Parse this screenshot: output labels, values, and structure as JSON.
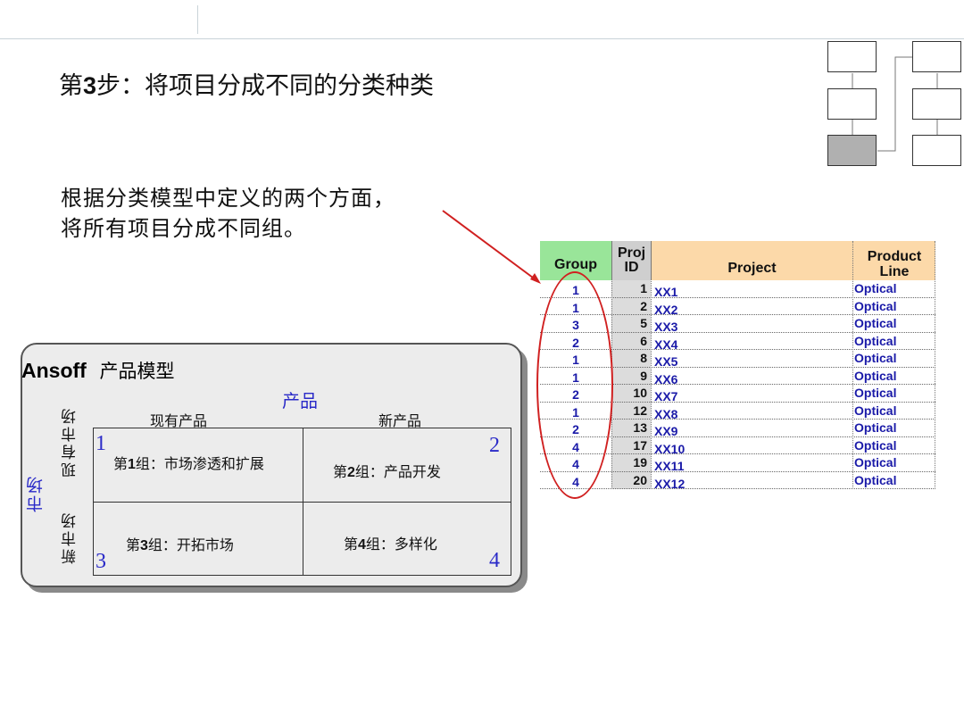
{
  "slide": {
    "title_prefix": "第",
    "title_num": "3",
    "title_suffix": "步：将项目分成不同的分类种类",
    "description": "根据分类模型中定义的两个方面，将所有项目分成不同组。"
  },
  "ansoff": {
    "title_en": "Ansoff",
    "title_zh": "产品模型",
    "product_axis": "产品",
    "market_axis": "市场",
    "col_existing": "现有产品",
    "col_new": "新产品",
    "row_existing": "现有市场",
    "row_new": "新市场",
    "quadrants": [
      {
        "num": "1",
        "prefix": "第",
        "n": "1",
        "suffix": "组：市场渗透和扩展"
      },
      {
        "num": "2",
        "prefix": "第",
        "n": "2",
        "suffix": "组：产品开发"
      },
      {
        "num": "3",
        "prefix": "第",
        "n": "3",
        "suffix": "组：开拓市场"
      },
      {
        "num": "4",
        "prefix": "第",
        "n": "4",
        "suffix": "组：多样化"
      }
    ]
  },
  "table": {
    "headers": {
      "group": "Group",
      "proj_id_1": "Proj",
      "proj_id_2": "ID",
      "project": "Project",
      "product_line_1": "Product",
      "product_line_2": "Line"
    },
    "rows": [
      {
        "group": "1",
        "id": "1",
        "project": "XX1",
        "line": "Optical"
      },
      {
        "group": "1",
        "id": "2",
        "project": "XX2",
        "line": "Optical"
      },
      {
        "group": "3",
        "id": "5",
        "project": "XX3",
        "line": "Optical"
      },
      {
        "group": "2",
        "id": "6",
        "project": "XX4",
        "line": "Optical"
      },
      {
        "group": "1",
        "id": "8",
        "project": "XX5",
        "line": "Optical"
      },
      {
        "group": "1",
        "id": "9",
        "project": "XX6",
        "line": "Optical"
      },
      {
        "group": "2",
        "id": "10",
        "project": "XX7",
        "line": "Optical"
      },
      {
        "group": "1",
        "id": "12",
        "project": "XX8",
        "line": "Optical"
      },
      {
        "group": "2",
        "id": "13",
        "project": "XX9",
        "line": "Optical"
      },
      {
        "group": "4",
        "id": "17",
        "project": "XX10",
        "line": "Optical"
      },
      {
        "group": "4",
        "id": "19",
        "project": "XX11",
        "line": "Optical"
      },
      {
        "group": "4",
        "id": "20",
        "project": "XX12",
        "line": "Optical"
      }
    ]
  },
  "colors": {
    "group_header": "#99e599",
    "id_header": "#cfcfcf",
    "project_header": "#fcd9a9",
    "highlight": "#d02020",
    "axis_text": "#2a2ac8"
  }
}
